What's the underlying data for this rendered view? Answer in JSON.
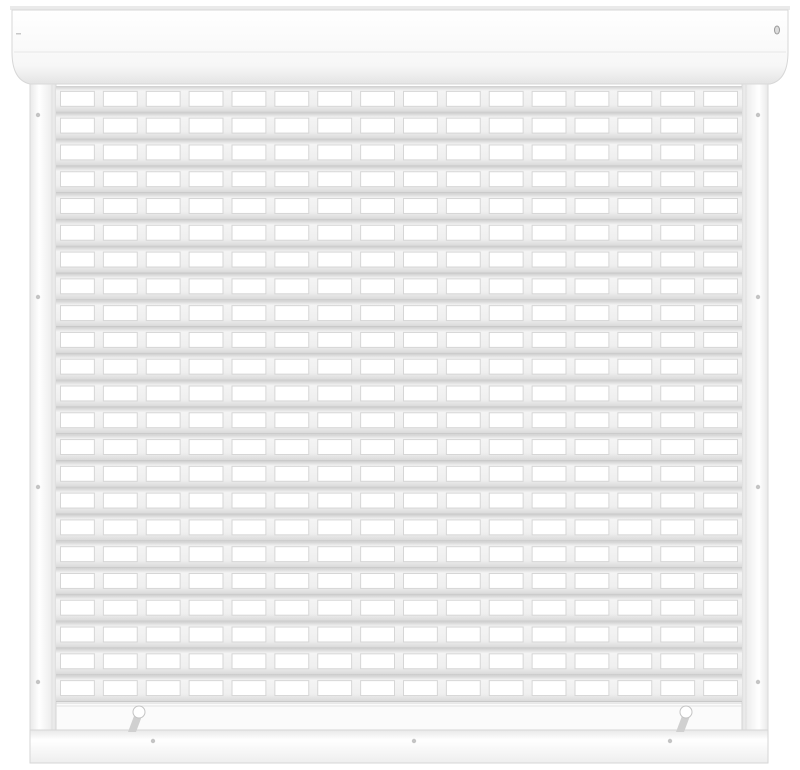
{
  "image": {
    "subject": "roller-shutter",
    "colors": {
      "frame": "#f7f7f7",
      "frame_edge": "#d2d2d2",
      "box_top": "#fbfbfb",
      "box_shadow": "#e2e2e2",
      "slat": "#f0f0f0",
      "slat_shadow": "#c9c9c9",
      "slot": "#ffffff",
      "slot_shadow": "#d6d6d6",
      "screw": "#c4c4c4"
    },
    "slat_count": 23,
    "slots_per_row": 16
  }
}
